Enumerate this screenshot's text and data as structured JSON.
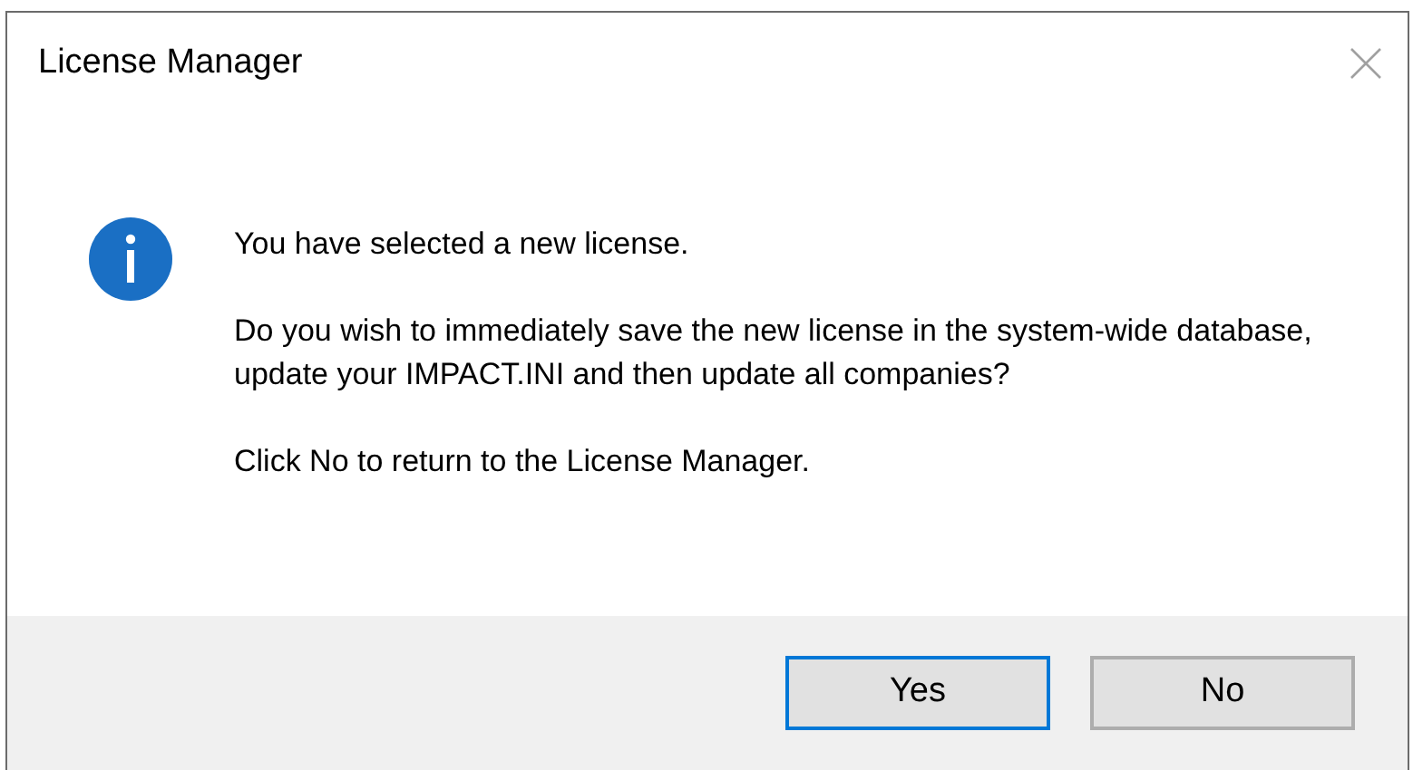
{
  "window": {
    "title": "License Manager"
  },
  "message": {
    "paragraphs": [
      "You have selected a new license.",
      "Do you wish to immediately save the new license in the system-wide database, update your IMPACT.INI and then update all companies?",
      "Click No to return to the License Manager."
    ]
  },
  "buttons": [
    {
      "label": "Yes",
      "default": true
    },
    {
      "label": "No",
      "default": false
    }
  ]
}
